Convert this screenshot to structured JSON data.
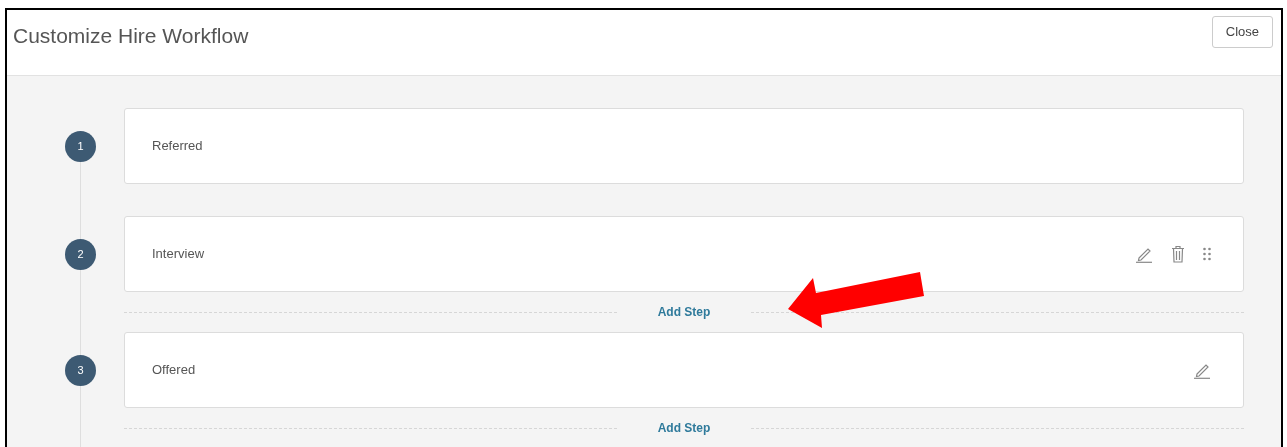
{
  "dialog": {
    "title": "Customize Hire Workflow",
    "close_label": "Close"
  },
  "steps": [
    {
      "number": "1",
      "name": "Referred",
      "editable": false,
      "deletable": false,
      "draggable": false
    },
    {
      "number": "2",
      "name": "Interview",
      "editable": true,
      "deletable": true,
      "draggable": true,
      "add_step_label": "Add Step"
    },
    {
      "number": "3",
      "name": "Offered",
      "editable": true,
      "deletable": false,
      "draggable": false,
      "add_step_label": "Add Step"
    }
  ]
}
